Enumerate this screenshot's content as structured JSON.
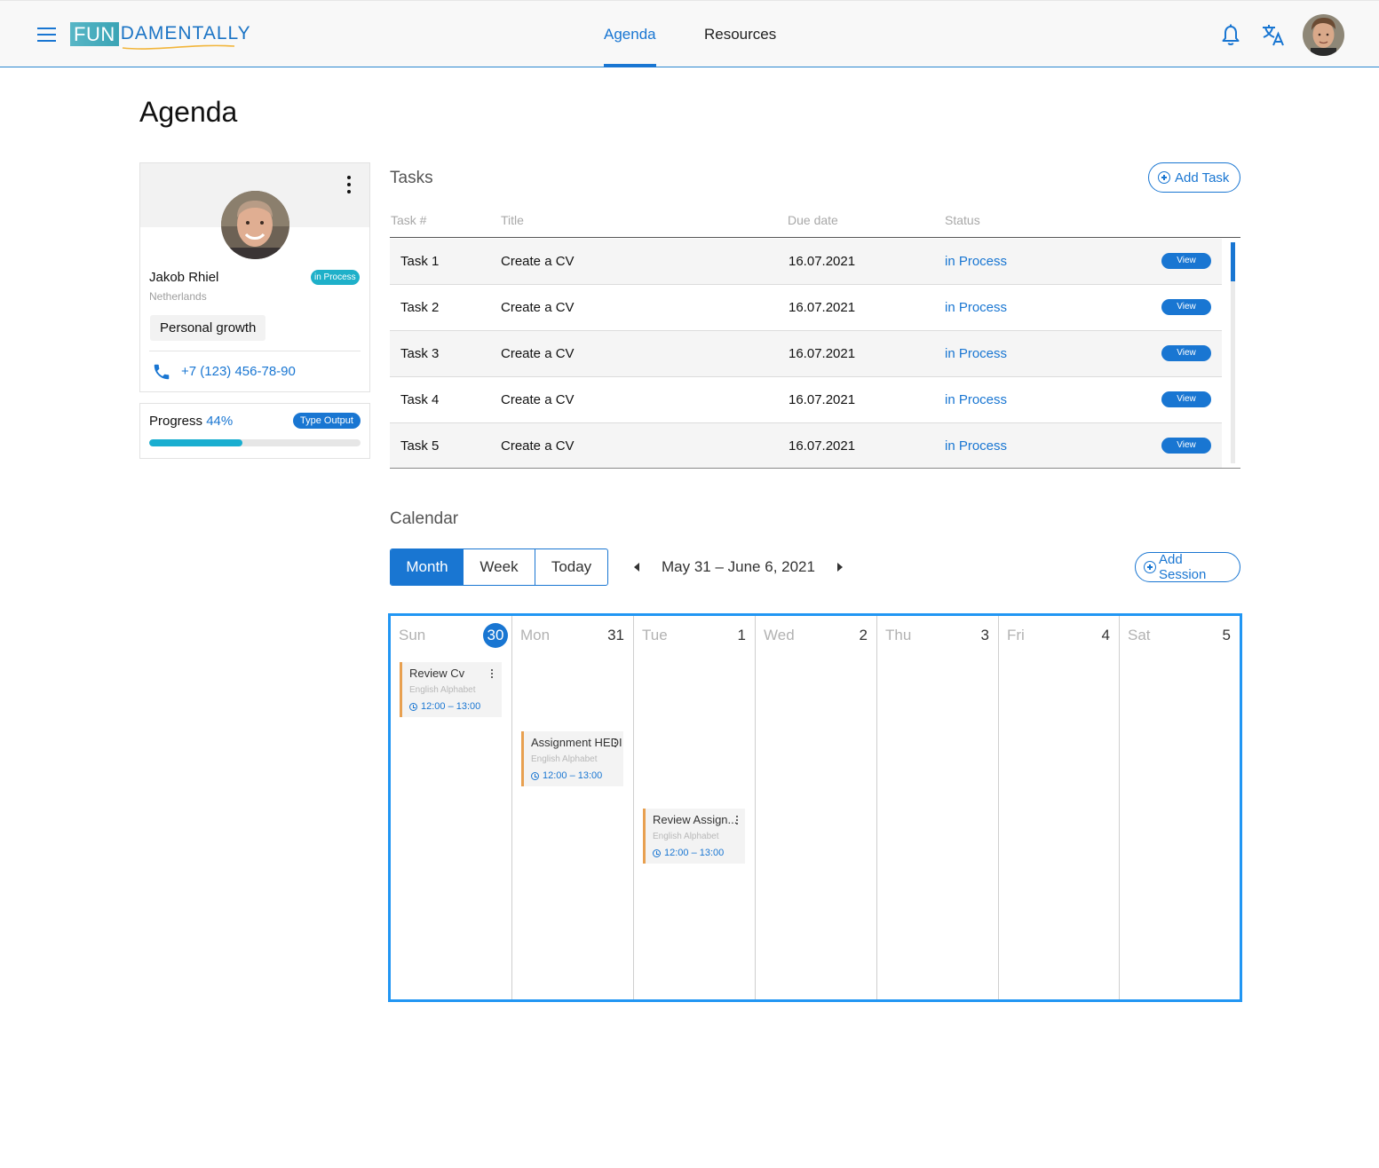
{
  "header": {
    "logo_fun": "FUN",
    "logo_rest": "DAMENTALLY",
    "nav": {
      "agenda": "Agenda",
      "resources": "Resources"
    },
    "icons": [
      "menu-icon",
      "bell-icon",
      "translate-icon",
      "avatar"
    ],
    "accent_color": "#1976d2"
  },
  "page": {
    "title": "Agenda"
  },
  "profile": {
    "name": "Jakob Rhiel",
    "country": "Netherlands",
    "status": "in Process",
    "category": "Personal growth",
    "phone": "+7 (123) 456-78-90"
  },
  "progress": {
    "label": "Progress",
    "value_text": "44%",
    "value": 0.44,
    "type_output": "Type Output"
  },
  "tasks": {
    "title": "Tasks",
    "add_label": "Add Task",
    "columns": {
      "num": "Task #",
      "title": "Title",
      "due": "Due date",
      "status": "Status"
    },
    "rows": [
      {
        "num": "Task 1",
        "title": "Create a CV",
        "due": "16.07.2021",
        "status": "in Process",
        "action": "View"
      },
      {
        "num": "Task 2",
        "title": "Create a CV",
        "due": "16.07.2021",
        "status": "in Process",
        "action": "View"
      },
      {
        "num": "Task 3",
        "title": "Create a CV",
        "due": "16.07.2021",
        "status": "in Process",
        "action": "View"
      },
      {
        "num": "Task 4",
        "title": "Create a CV",
        "due": "16.07.2021",
        "status": "in Process",
        "action": "View"
      },
      {
        "num": "Task 5",
        "title": "Create a CV",
        "due": "16.07.2021",
        "status": "in Process",
        "action": "View"
      }
    ]
  },
  "calendar": {
    "title": "Calendar",
    "views": {
      "month": "Month",
      "week": "Week",
      "today": "Today"
    },
    "selected_view": "Month",
    "range": "May 31 – June 6, 2021",
    "add_session": "Add Session",
    "days": [
      {
        "name": "Sun",
        "num": "30",
        "today": true
      },
      {
        "name": "Mon",
        "num": "31"
      },
      {
        "name": "Tue",
        "num": "1"
      },
      {
        "name": "Wed",
        "num": "2"
      },
      {
        "name": "Thu",
        "num": "3"
      },
      {
        "name": "Fri",
        "num": "4"
      },
      {
        "name": "Sat",
        "num": "5"
      }
    ],
    "events": [
      {
        "day": "Sun",
        "title": "Review Cv",
        "subtitle": "English Alphabet",
        "time": "12:00 – 13:00"
      },
      {
        "day": "Mon",
        "title": "Assignment  HEDI",
        "subtitle": "English Alphabet",
        "time": "12:00 – 13:00"
      },
      {
        "day": "Tue",
        "title": "Review  Assign...",
        "subtitle": "English Alphabet",
        "time": "12:00 – 13:00"
      }
    ]
  }
}
